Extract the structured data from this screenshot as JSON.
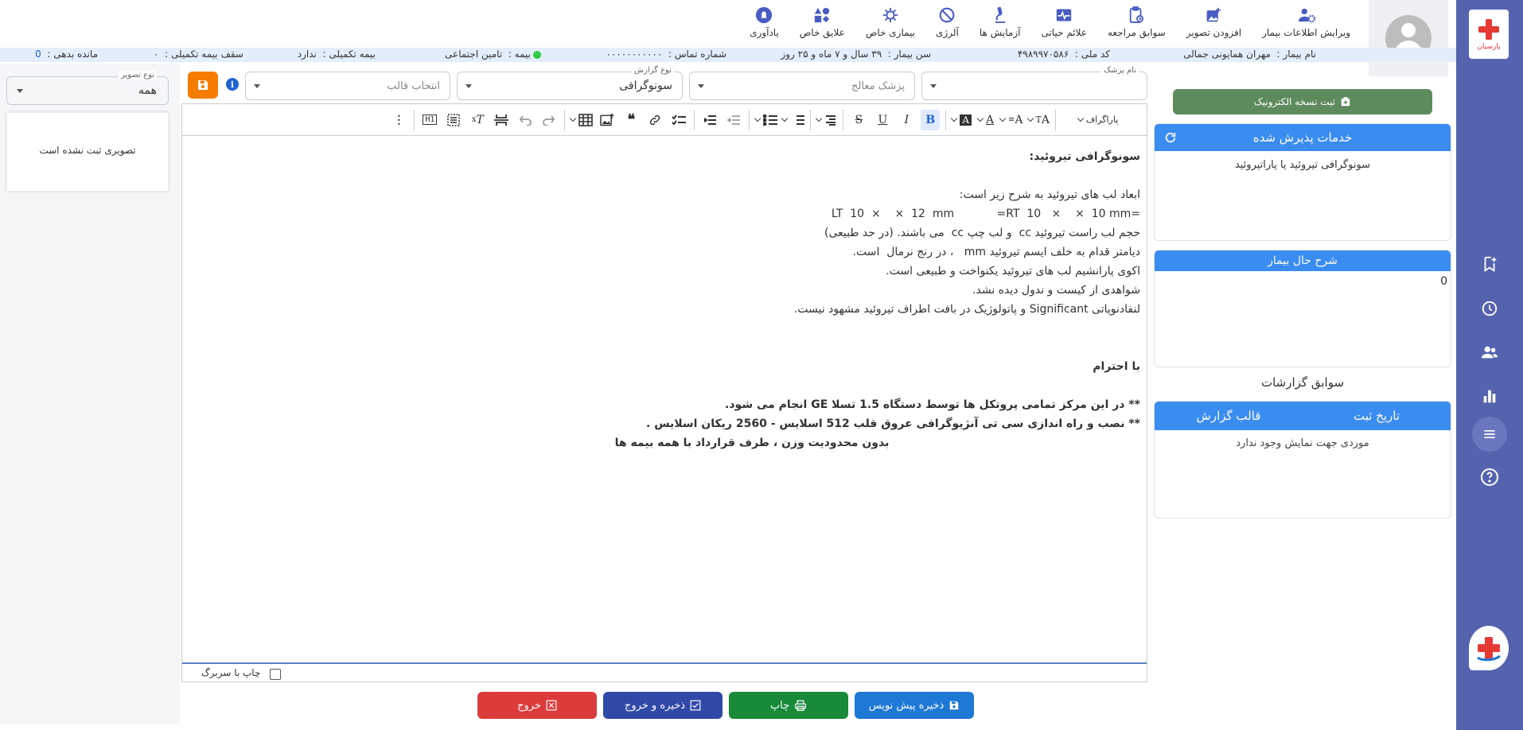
{
  "app": {
    "logo_text": "پارسیان"
  },
  "toolbar": {
    "items": [
      {
        "label": "ویرایش اطلاعات بیمار",
        "icon": "user-gear-icon"
      },
      {
        "label": "افزودن تصویر",
        "icon": "add-image-icon"
      },
      {
        "label": "سوابق مراجعه",
        "icon": "clipboard-history-icon"
      },
      {
        "label": "علائم حیاتی",
        "icon": "vitals-icon"
      },
      {
        "label": "آزمایش ها",
        "icon": "microscope-icon"
      },
      {
        "label": "آلرژی",
        "icon": "allergy-icon"
      },
      {
        "label": "بیماری خاص",
        "icon": "virus-icon"
      },
      {
        "label": "علایق خاص",
        "icon": "interests-icon"
      },
      {
        "label": "یادآوری",
        "icon": "bell-icon"
      }
    ]
  },
  "patient": {
    "name_label": "نام بیمار :",
    "name": "مهران همایونی جمالی",
    "national_id_label": "کد ملی :",
    "national_id": "۴۹۸۹۹۷۰۵۸۶",
    "age_label": "سن بیمار :",
    "age": "۳۹ سال و ۷ ماه و ۲۵ روز",
    "phone_label": "شماره تماس :",
    "phone": "۰۰۰۰۰۰۰۰۰۰۰",
    "insurance_label": "بیمه :",
    "insurance": "تامین اجتماعی",
    "supp_insurance_label": "بیمه تکمیلی :",
    "supp_insurance": "ندارد",
    "supp_ceiling_label": "سقف بیمه تکمیلی :",
    "supp_ceiling": "۰",
    "debt_label": "مانده بدهی :",
    "debt": "0"
  },
  "right_panel": {
    "e_copy_button": "ثبت نسخه الکترونیک",
    "services_title": "خدمات پذیرش شده",
    "services": [
      "سونوگرافی تیروئید یا پاراتیروئید"
    ],
    "history_desc_title": "شرح حال بیمار",
    "history_desc_value": "0",
    "reports_history_title": "سوابق گزارشات",
    "reports_columns": [
      "تاریخ ثبت",
      "قالب گزارش"
    ],
    "reports_empty": "موردی جهت نمایش وجود ندارد"
  },
  "form": {
    "doctor_label": "نام پزشک",
    "doctor_value": "",
    "treating_doctor_placeholder": "پزشک معالج",
    "report_type_label": "نوع گزارش",
    "report_type_value": "سونوگرافی",
    "template_placeholder": "انتخاب قالب",
    "image_type_label": "نوع تصویر",
    "image_type_value": "همه",
    "no_image_text": "تصویری ثبت نشده است"
  },
  "editor": {
    "paragraph_select": "پاراگراف",
    "lines": [
      {
        "text": "سونوگرافی تیروئید:",
        "bold": true
      },
      {
        "text": "",
        "bold": false
      },
      {
        "text": "ابعاد لب های تیروئید به شرح زیر است:",
        "bold": false
      },
      {
        "text": "LT  10  ×    ×  12  mm            =RT  10   ×    ×  10 mm=",
        "bold": false
      },
      {
        "text": "حجم لب راست تیروئید cc  و لب چپ cc  می باشند. (در حد طبیعی)",
        "bold": false
      },
      {
        "text": "دیامتر قدام به خلف ایسم تیروئید mm   ، در رنج نرمال  است.",
        "bold": false
      },
      {
        "text": "اکوی پارانشیم لب های تیروئید یکنواخت و طبیعی است.",
        "bold": false
      },
      {
        "text": "شواهدی از کیست و ندول دیده نشد.",
        "bold": false
      },
      {
        "text": "لنفادنوپاتی Significant و پاتولوژیک در بافت اطراف تیروئید مشهود نیست.",
        "bold": false
      },
      {
        "text": "",
        "bold": false
      },
      {
        "text": "",
        "bold": false
      },
      {
        "text": "با احترام",
        "bold": true
      },
      {
        "text": "",
        "bold": false
      },
      {
        "text": "** در این مرکز تمامی پروتکل ها توسط دستگاه 1.5 تسلا GE انجام می شود.",
        "bold": true
      },
      {
        "text": "** نصب و راه اندازی سی تی آنژیوگرافی عروق قلب 512 اسلایس - 2560 ریکان اسلایس .",
        "bold": true
      },
      {
        "text": "بدون محدودیت وزن ، طرف قرارداد با همه بیمه ها",
        "bold": true,
        "center": true
      }
    ],
    "print_header_label": "چاپ با سربرگ"
  },
  "actions": {
    "save_draft": "ذخیره پیش نویس",
    "print": "چاپ",
    "save_exit": "ذخیره و خروج",
    "exit": "خروج"
  },
  "colors": {
    "rail": "#5563ae",
    "primary_header": "#3b8cf0",
    "green_button": "#5e8b5e",
    "save_draft": "#1e78d6",
    "print": "#188a3a",
    "save_exit": "#3049a8",
    "exit": "#dc3b3b",
    "orange": "#f57c00"
  }
}
